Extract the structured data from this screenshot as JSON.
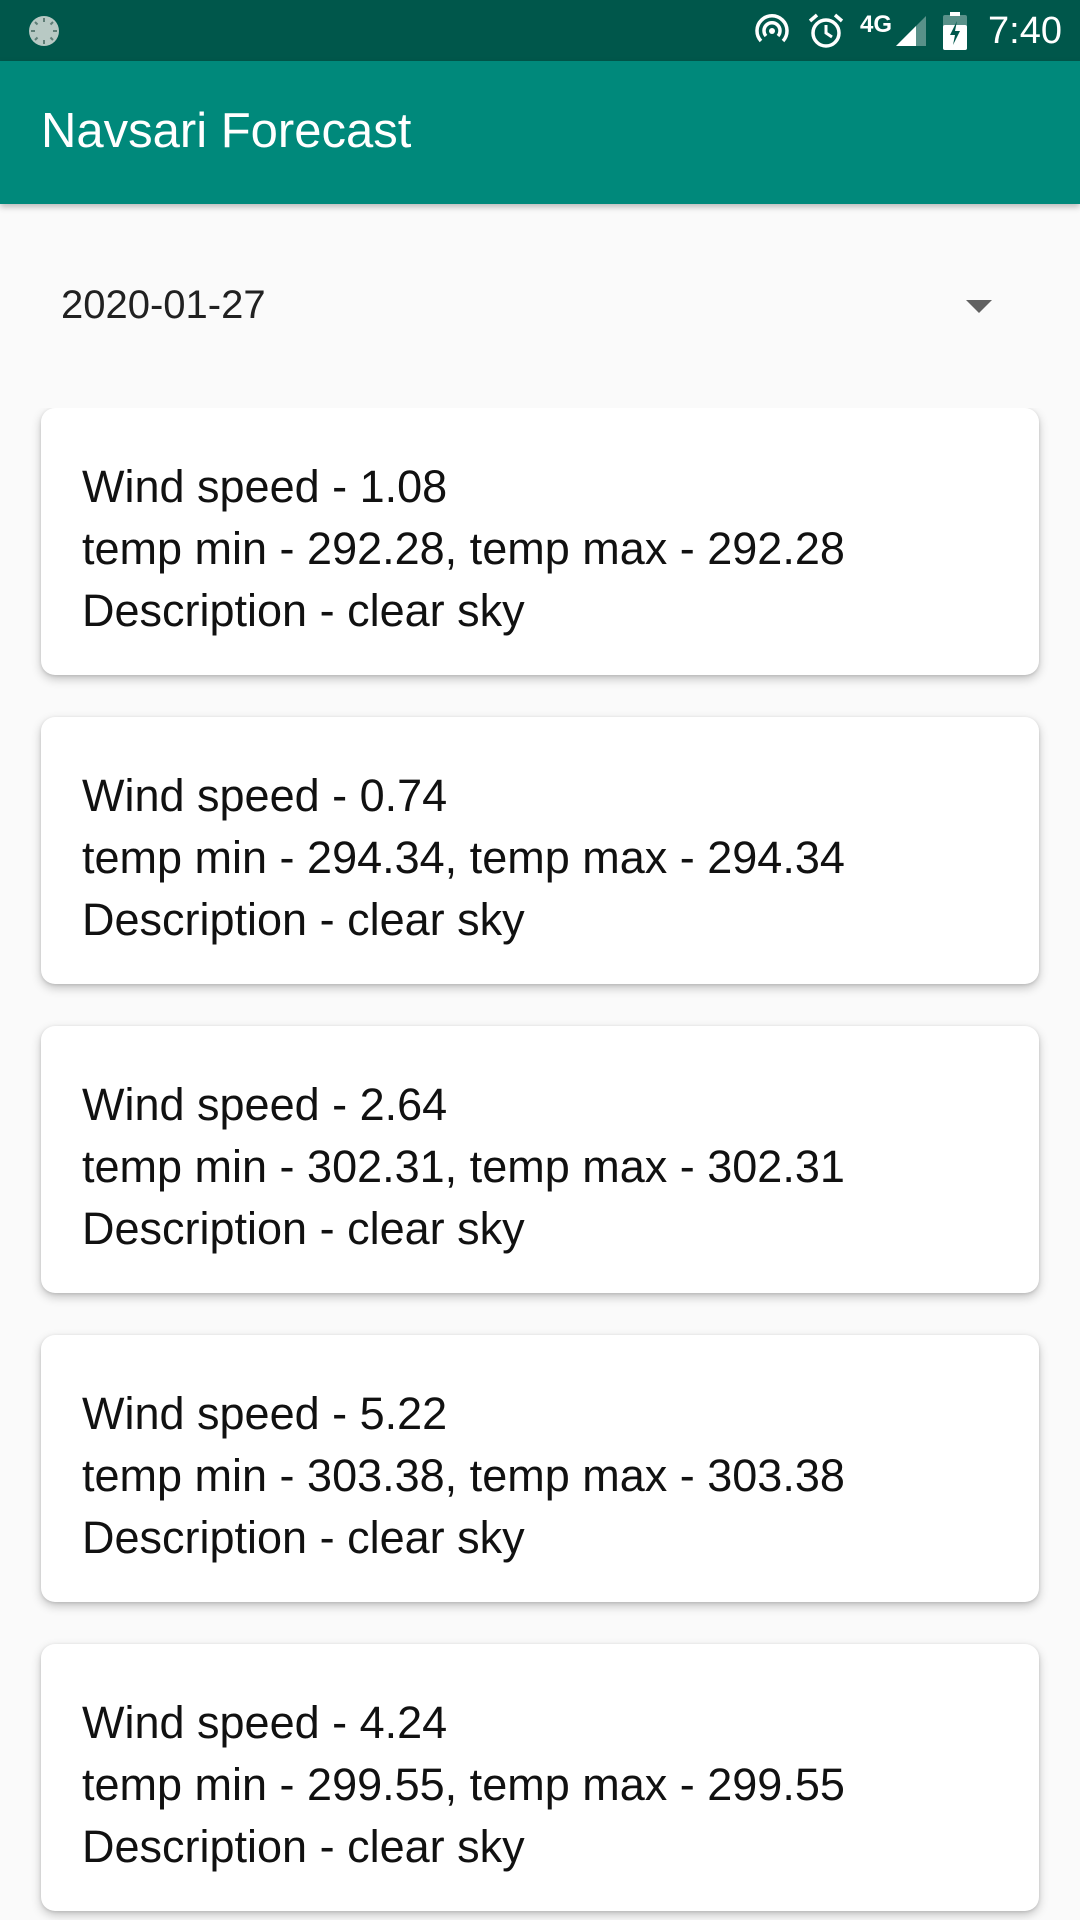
{
  "status_bar": {
    "time": "7:40",
    "network": "4G",
    "colors": {
      "background": "#00574b"
    },
    "icons": [
      "loading-icon",
      "hotspot-icon",
      "alarm-icon",
      "signal-icon",
      "battery-icon"
    ]
  },
  "app_bar": {
    "title": "Navsari Forecast",
    "color": "#00897b"
  },
  "date_spinner": {
    "selected": "2020-01-27"
  },
  "forecast": [
    {
      "wind": "Wind speed - 1.08",
      "temp": "temp min - 292.28, temp max - 292.28",
      "description": "Description - clear sky"
    },
    {
      "wind": "Wind speed - 0.74",
      "temp": "temp min - 294.34, temp max - 294.34",
      "description": "Description - clear sky"
    },
    {
      "wind": "Wind speed - 2.64",
      "temp": "temp min - 302.31, temp max - 302.31",
      "description": "Description - clear sky"
    },
    {
      "wind": "Wind speed - 5.22",
      "temp": "temp min - 303.38, temp max - 303.38",
      "description": "Description - clear sky"
    },
    {
      "wind": "Wind speed - 4.24",
      "temp": "temp min - 299.55, temp max - 299.55",
      "description": "Description - clear sky"
    }
  ]
}
